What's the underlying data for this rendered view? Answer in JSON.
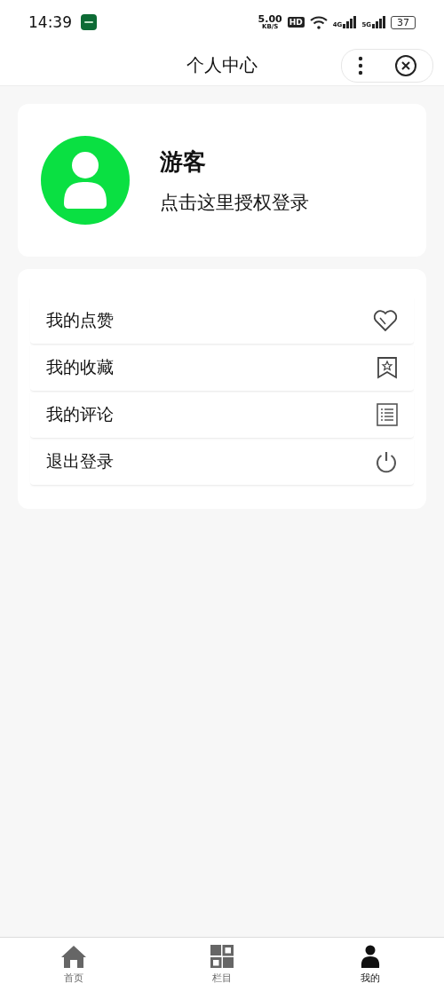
{
  "status_bar": {
    "time": "14:39",
    "speed": "5.00",
    "speed_unit": "KB/S",
    "hd": "HD",
    "network_1": "4G",
    "network_2": "5G",
    "battery": "37"
  },
  "nav_bar": {
    "title": "个人中心"
  },
  "profile": {
    "name": "游客",
    "action": "点击这里授权登录"
  },
  "menu": [
    {
      "label": "我的点赞",
      "kind": "heart"
    },
    {
      "label": "我的收藏",
      "kind": "bookmark"
    },
    {
      "label": "我的评论",
      "kind": "list"
    },
    {
      "label": "退出登录",
      "kind": "power"
    }
  ],
  "tab_bar": [
    {
      "label": "首页",
      "kind": "home",
      "selected": false
    },
    {
      "label": "栏目",
      "kind": "grid",
      "selected": false
    },
    {
      "label": "我的",
      "kind": "person",
      "selected": true
    }
  ]
}
